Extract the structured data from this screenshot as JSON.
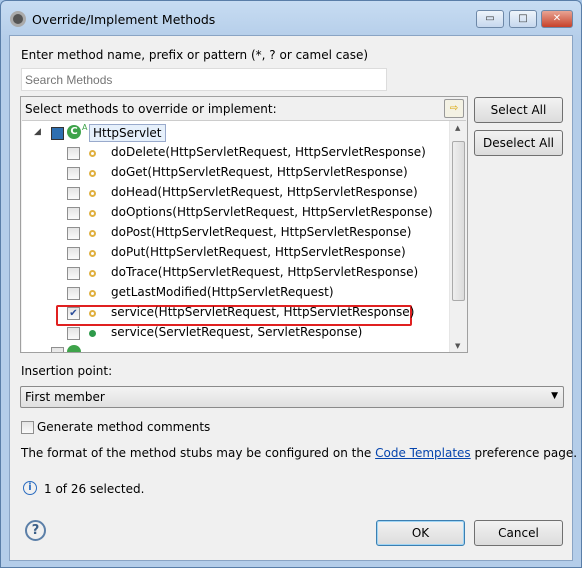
{
  "window": {
    "title": "Override/Implement Methods",
    "controls": {
      "minimize": "▭",
      "maximize": "□",
      "close": "✕"
    }
  },
  "search": {
    "label": "Enter method name, prefix or pattern (*, ? or camel case)",
    "placeholder": "Search Methods",
    "value": ""
  },
  "tree": {
    "header": "Select methods to override or implement:",
    "root": {
      "label": "HttpServlet",
      "checked": "partial"
    },
    "items": [
      {
        "label": "doDelete(HttpServletRequest, HttpServletResponse)",
        "checked": false,
        "visibility": "protected"
      },
      {
        "label": "doGet(HttpServletRequest, HttpServletResponse)",
        "checked": false,
        "visibility": "protected"
      },
      {
        "label": "doHead(HttpServletRequest, HttpServletResponse)",
        "checked": false,
        "visibility": "protected"
      },
      {
        "label": "doOptions(HttpServletRequest, HttpServletResponse)",
        "checked": false,
        "visibility": "protected"
      },
      {
        "label": "doPost(HttpServletRequest, HttpServletResponse)",
        "checked": false,
        "visibility": "protected"
      },
      {
        "label": "doPut(HttpServletRequest, HttpServletResponse)",
        "checked": false,
        "visibility": "protected"
      },
      {
        "label": "doTrace(HttpServletRequest, HttpServletResponse)",
        "checked": false,
        "visibility": "protected"
      },
      {
        "label": "getLastModified(HttpServletRequest)",
        "checked": false,
        "visibility": "protected"
      },
      {
        "label": "service(HttpServletRequest, HttpServletResponse)",
        "checked": true,
        "visibility": "protected",
        "highlighted": true
      },
      {
        "label": "service(ServletRequest, ServletResponse)",
        "checked": false,
        "visibility": "public"
      }
    ]
  },
  "buttons": {
    "select_all": "Select All",
    "deselect_all": "Deselect All",
    "ok": "OK",
    "cancel": "Cancel"
  },
  "insertion": {
    "label": "Insertion point:",
    "value": "First member"
  },
  "generate_comments": {
    "label": "Generate method comments",
    "checked": false
  },
  "format_text": {
    "before": "The format of the method stubs may be configured on the ",
    "link": "Code Templates",
    "after": " preference page."
  },
  "status": "1 of 26 selected.",
  "colors": {
    "protected": "#e0b040",
    "public": "#2e9a4a",
    "highlight": "#e02020"
  }
}
